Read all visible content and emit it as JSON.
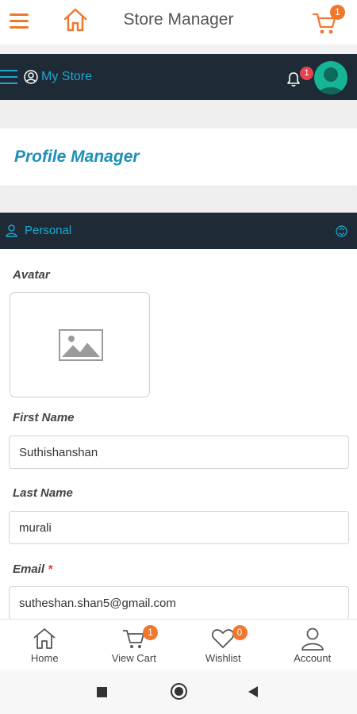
{
  "appbar": {
    "title": "Store Manager",
    "cart_count": "1"
  },
  "storebar": {
    "store_label": "My Store",
    "notification_count": "1"
  },
  "profile_manager": {
    "title": "Profile Manager"
  },
  "section": {
    "label": "Personal"
  },
  "form": {
    "avatar_label": "Avatar",
    "first_name_label": "First Name",
    "first_name_value": "Suthishanshan",
    "last_name_label": "Last Name",
    "last_name_value": "murali",
    "email_label": "Email",
    "email_required_mark": "*",
    "email_value": "sutheshan.shan5@gmail.com"
  },
  "bottom_nav": {
    "items": [
      {
        "label": "Home",
        "icon": "home-icon"
      },
      {
        "label": "View Cart",
        "icon": "cart-icon",
        "badge": "1"
      },
      {
        "label": "Wishlist",
        "icon": "heart-icon",
        "badge": "0"
      },
      {
        "label": "Account",
        "icon": "user-icon"
      }
    ]
  },
  "colors": {
    "accent_orange": "#f0782e",
    "accent_blue": "#1ea7d1",
    "dark_bar": "#1e2b36",
    "avatar_teal": "#17b597"
  }
}
